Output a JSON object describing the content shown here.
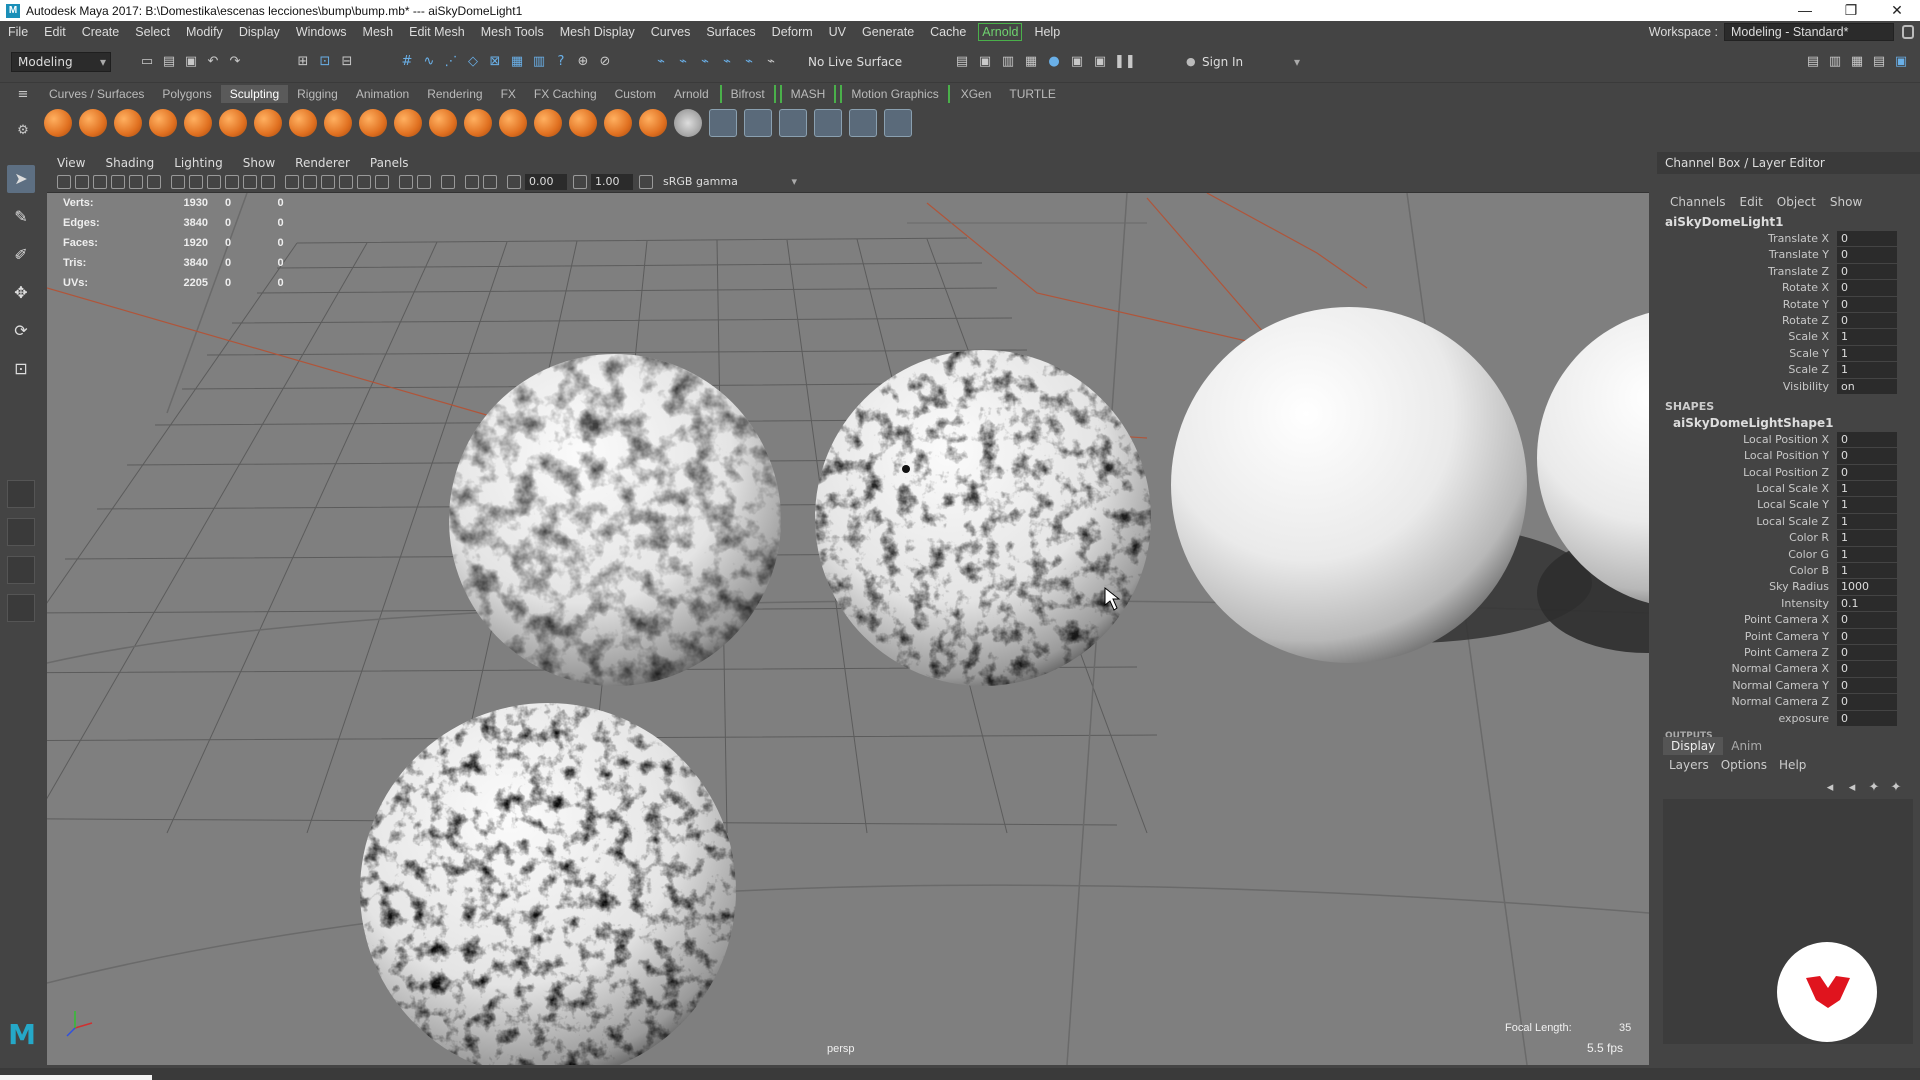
{
  "window": {
    "title": "Autodesk Maya 2017: B:\\Domestika\\escenas lecciones\\bump\\bump.mb*   ---   aiSkyDomeLight1",
    "controls": [
      "—",
      "❐",
      "✕"
    ]
  },
  "menubar": {
    "items": [
      "File",
      "Edit",
      "Create",
      "Select",
      "Modify",
      "Display",
      "Windows",
      "Mesh",
      "Edit Mesh",
      "Mesh Tools",
      "Mesh Display",
      "Curves",
      "Surfaces",
      "Deform",
      "UV",
      "Generate",
      "Cache",
      "Arnold",
      "Help"
    ],
    "workspace_label": "Workspace :",
    "workspace_value": "Modeling - Standard*"
  },
  "statusline": {
    "mode": "Modeling",
    "live_surface": "No Live Surface",
    "sign_in": "Sign In"
  },
  "shelf": {
    "tabs": [
      "Curves / Surfaces",
      "Polygons",
      "Sculpting",
      "Rigging",
      "Animation",
      "Rendering",
      "FX",
      "FX Caching",
      "Custom",
      "Arnold",
      "Bifrost",
      "MASH",
      "Motion Graphics",
      "XGen",
      "TURTLE"
    ],
    "active_tab": "Sculpting"
  },
  "viewport": {
    "menus": [
      "View",
      "Shading",
      "Lighting",
      "Show",
      "Renderer",
      "Panels"
    ],
    "exposure": "0.00",
    "gamma": "1.00",
    "color_space": "sRGB gamma",
    "hud": [
      {
        "label": "Verts:",
        "value": "1930",
        "a": "0",
        "b": "0"
      },
      {
        "label": "Edges:",
        "value": "3840",
        "a": "0",
        "b": "0"
      },
      {
        "label": "Faces:",
        "value": "1920",
        "a": "0",
        "b": "0"
      },
      {
        "label": "Tris:",
        "value": "3840",
        "a": "0",
        "b": "0"
      },
      {
        "label": "UVs:",
        "value": "2205",
        "a": "0",
        "b": "0"
      }
    ],
    "camera": "persp",
    "focal_length_label": "Focal Length:",
    "focal_length": "35",
    "fps": "5.5 fps"
  },
  "channel_box": {
    "header": "Channel Box / Layer Editor",
    "menus": [
      "Channels",
      "Edit",
      "Object",
      "Show"
    ],
    "node": "aiSkyDomeLight1",
    "transform_attrs": [
      {
        "name": "Translate X",
        "value": "0"
      },
      {
        "name": "Translate Y",
        "value": "0"
      },
      {
        "name": "Translate Z",
        "value": "0"
      },
      {
        "name": "Rotate X",
        "value": "0"
      },
      {
        "name": "Rotate Y",
        "value": "0"
      },
      {
        "name": "Rotate Z",
        "value": "0"
      },
      {
        "name": "Scale X",
        "value": "1"
      },
      {
        "name": "Scale Y",
        "value": "1"
      },
      {
        "name": "Scale Z",
        "value": "1"
      },
      {
        "name": "Visibility",
        "value": "on"
      }
    ],
    "shapes_label": "SHAPES",
    "shape_node": "aiSkyDomeLightShape1",
    "shape_attrs": [
      {
        "name": "Local Position X",
        "value": "0"
      },
      {
        "name": "Local Position Y",
        "value": "0"
      },
      {
        "name": "Local Position Z",
        "value": "0"
      },
      {
        "name": "Local Scale X",
        "value": "1"
      },
      {
        "name": "Local Scale Y",
        "value": "1"
      },
      {
        "name": "Local Scale Z",
        "value": "1"
      },
      {
        "name": "Color R",
        "value": "1"
      },
      {
        "name": "Color G",
        "value": "1"
      },
      {
        "name": "Color B",
        "value": "1"
      },
      {
        "name": "Sky Radius",
        "value": "1000"
      },
      {
        "name": "Intensity",
        "value": "0.1"
      },
      {
        "name": "Point Camera X",
        "value": "0"
      },
      {
        "name": "Point Camera Y",
        "value": "0"
      },
      {
        "name": "Point Camera Z",
        "value": "0"
      },
      {
        "name": "Normal Camera X",
        "value": "0"
      },
      {
        "name": "Normal Camera Y",
        "value": "0"
      },
      {
        "name": "Normal Camera Z",
        "value": "0"
      },
      {
        "name": "exposure",
        "value": "0"
      }
    ],
    "outputs_label": "OUTPUTS"
  },
  "layer_editor": {
    "tabs": [
      "Display",
      "Anim"
    ],
    "active_tab": "Display",
    "menus": [
      "Layers",
      "Options",
      "Help"
    ]
  },
  "colors": {
    "panel_bg": "#444444",
    "viewport_bg": "#7f7f7f",
    "accent_blue": "#5d6f82",
    "arnold_green": "#4ab04a",
    "badge_red": "#e0141e"
  }
}
